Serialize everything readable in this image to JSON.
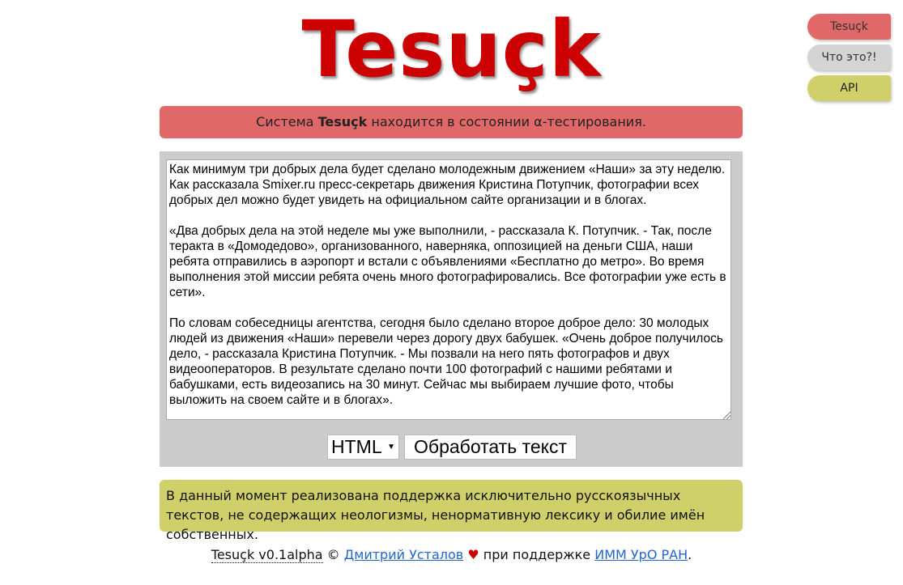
{
  "logo": {
    "text": "Tesuçk"
  },
  "nav": {
    "items": [
      {
        "label": "Tesuçk"
      },
      {
        "label": "Что это?!"
      },
      {
        "label": "API"
      }
    ]
  },
  "banner": {
    "prefix": "Система",
    "name": "Tesuçk",
    "suffix": "находится в состоянии α-тестирования."
  },
  "editor": {
    "text": "Как минимум три добрых дела будет сделано молодежным движением «Наши» за эту неделю. Как рассказала Smixer.ru пресс-секретарь движения Кристина Потупчик, фотографии всех добрых дел можно будет увидеть на официальном сайте организации и в блогах.\n\n«Два добрых дела на этой неделе мы уже выполнили, - рассказала К. Потупчик. - Так, после теракта в «Домодедово», организованного, наверняка, оппозицией на деньги США, наши ребята отправились в аэропорт и встали с объявлениями «Бесплатно до метро». Во время выполнения этой миссии ребята очень много фотографировались. Все фотографии уже есть в сети».\n\nПо словам собеседницы агентства, сегодня было сделано второе доброе дело: 30 молодых людей из движения «Наши» перевели через дорогу двух бабушек. «Очень доброе получилось дело, - рассказала Кристина Потупчик. - Мы позвали на него пять фотографов и двух видеооператоров. В результате сделано почти 100 фотографий с нашими ребятами и бабушками, есть видеозапись на 30 минут. Сейчас мы выбираем лучшие фото, чтобы выложить на своем сайте и в блогах».",
    "format_selected": "HTML",
    "submit_label": "Обработать текст"
  },
  "notice": {
    "text": "В данный момент реализована поддержка исключительно русскоязычных текстов, не содержащих неологизмы, ненормативную лексику и обилие имён собственных."
  },
  "footer": {
    "version": "Tesuçk v0.1alpha",
    "copyright": "©",
    "author": "Дмитрий Усталов",
    "heart": "♥",
    "support": "при поддержке",
    "org": "ИММ УрО РАН",
    "end": "."
  },
  "colors": {
    "logo": "#cc0000",
    "banner": "#e06868",
    "panel": "#cccccc",
    "notice": "#cfd06a",
    "link": "#2266cc"
  }
}
